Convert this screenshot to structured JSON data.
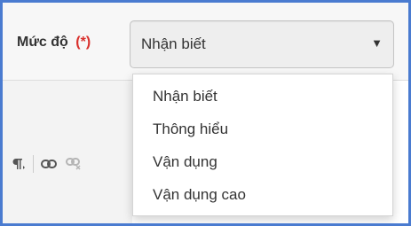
{
  "field": {
    "label": "Mức độ",
    "required_mark": "(*)"
  },
  "select": {
    "value": "Nhận biết",
    "caret": "▼"
  },
  "options": [
    {
      "label": "Nhận biết",
      "selected": true
    },
    {
      "label": "Thông hiểu",
      "selected": false
    },
    {
      "label": "Vận dụng",
      "selected": false
    },
    {
      "label": "Vận dụng cao",
      "selected": false
    }
  ],
  "toolbar": {
    "paragraph_icon": "paragraph-icon",
    "link_icon": "link-icon",
    "unlink_icon": "unlink-icon"
  },
  "colors": {
    "frame_border": "#4a7bd0",
    "required": "#d9302c"
  }
}
